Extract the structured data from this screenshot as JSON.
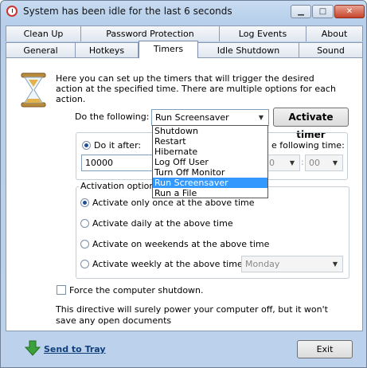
{
  "window": {
    "title": "System has been idle for the last 6 seconds",
    "min_glyph": "▁",
    "max_glyph": "□",
    "close_glyph": "✕"
  },
  "tabs_row1": [
    "Clean Up",
    "Password Protection",
    "Log Events",
    "About"
  ],
  "tabs_row2": [
    "General",
    "Hotkeys",
    "Timers",
    "Idle Shutdown",
    "Sound"
  ],
  "active_tab": "Timers",
  "intro_text": "Here you can set up the timers that will trigger the desired action at the specified time. There are multiple options for each action.",
  "action": {
    "label": "Do the following:",
    "selected": "Run Screensaver",
    "button": "Activate timer",
    "options": [
      "Shutdown",
      "Restart",
      "Hibernate",
      "Log Off User",
      "Turn Off Monitor",
      "Run Screensaver",
      "Run a File"
    ]
  },
  "timer": {
    "do_it_after_label": "Do it after:",
    "after_value": "10000",
    "following_time_label": "e following time:",
    "hour_value": "0",
    "minute_value": "00"
  },
  "activation": {
    "group_label": "Activation options:",
    "options": [
      "Activate only once at the above time",
      "Activate daily at the above time",
      "Activate on weekends at the above time",
      "Activate weekly at the above time on"
    ],
    "weekday": "Monday"
  },
  "force_shutdown_label": "Force the computer shutdown.",
  "note_text": "This directive will surely power your computer off, but it won't save any open documents",
  "footer": {
    "send_to_tray": "Send to Tray",
    "exit": "Exit"
  },
  "colors": {
    "selection": "#3399ff",
    "link": "#103e7a",
    "window_frame": "#b7cfea"
  }
}
